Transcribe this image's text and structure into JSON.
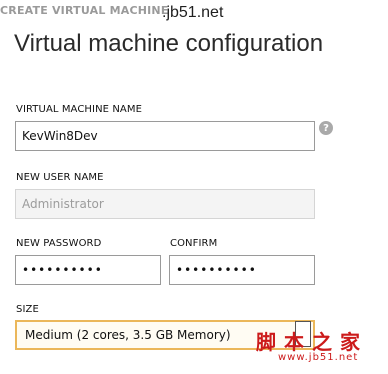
{
  "watermark": {
    "top_text": "CREATE VIRTUAL MACHINE",
    "site_text": ".jb51.net",
    "logo_text": "脚本之家",
    "logo_url": "www.jb51.net"
  },
  "page": {
    "title": "Virtual machine configuration"
  },
  "form": {
    "vm_name": {
      "label": "VIRTUAL MACHINE NAME",
      "value": "KevWin8Dev",
      "help_icon": "?"
    },
    "user_name": {
      "label": "NEW USER NAME",
      "placeholder": "Administrator"
    },
    "password": {
      "label": "NEW PASSWORD",
      "value": "••••••••••"
    },
    "confirm": {
      "label": "CONFIRM",
      "value": "••••••••••"
    },
    "size": {
      "label": "SIZE",
      "value": "Medium (2 cores, 3.5 GB Memory)"
    }
  }
}
